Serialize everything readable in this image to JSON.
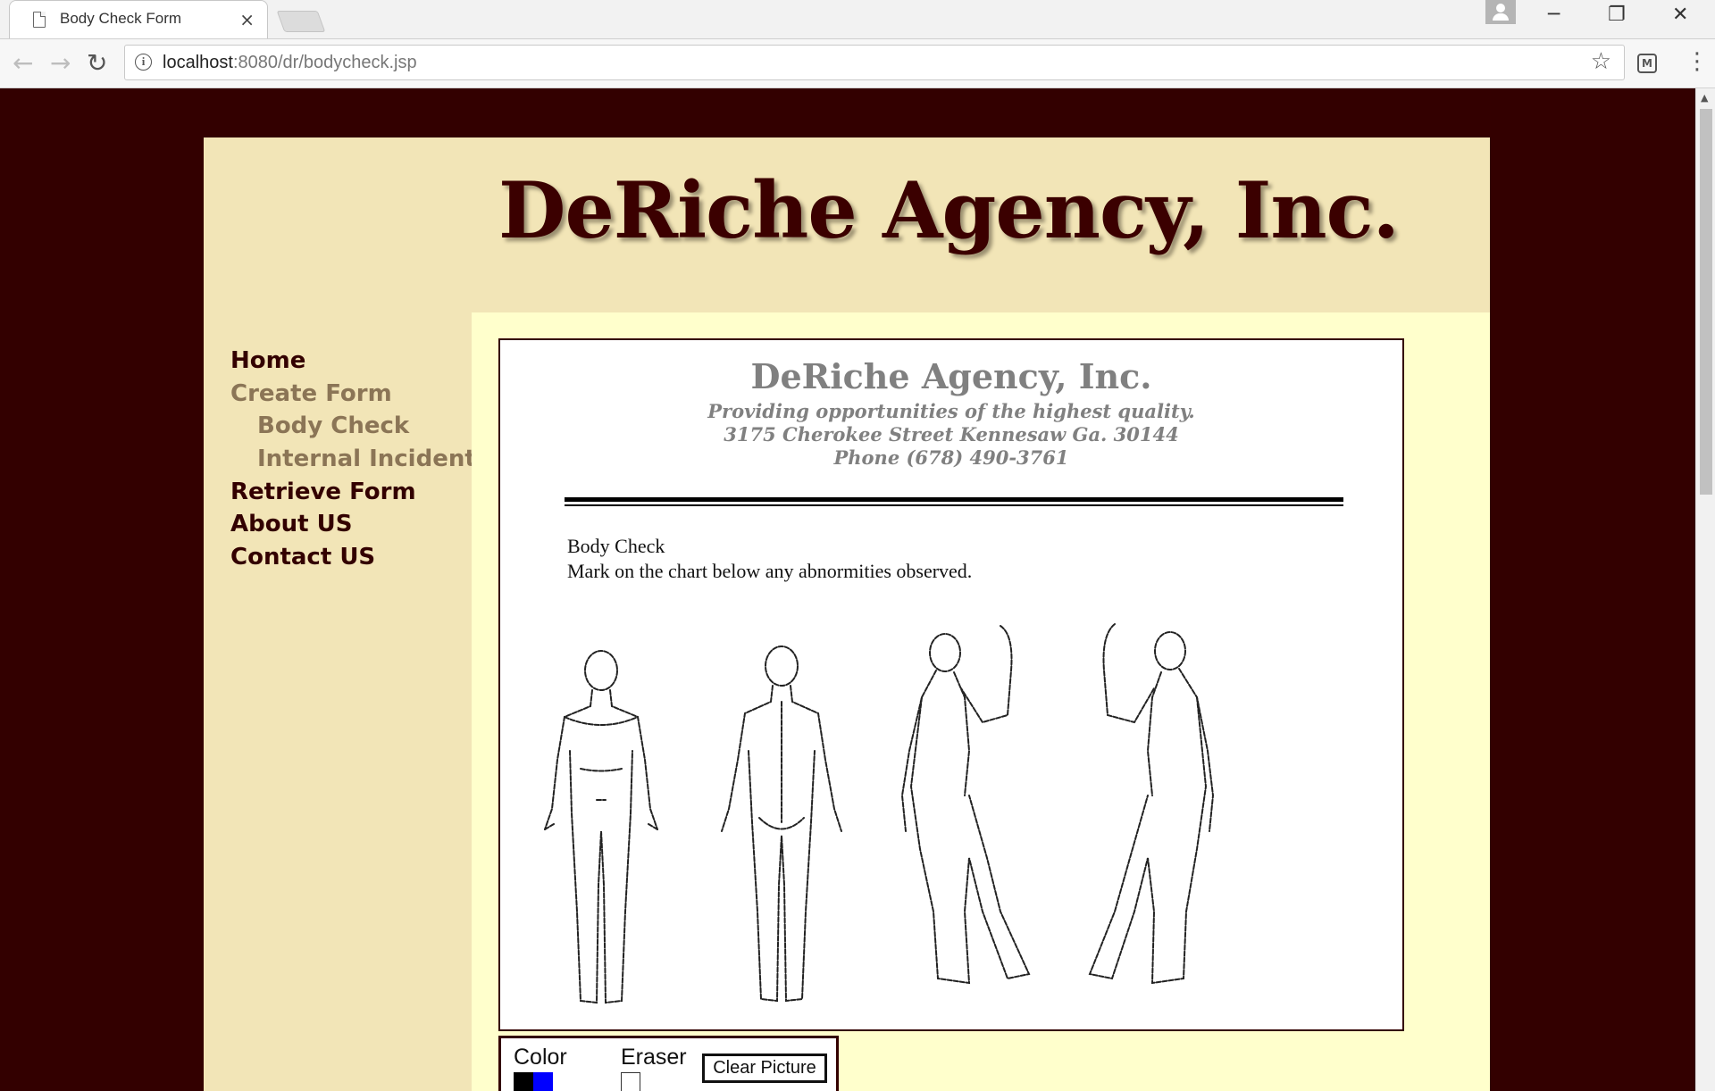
{
  "browser": {
    "tab_title": "Body Check Form",
    "tab_close": "×",
    "url_host": "localhost",
    "url_path": ":8080/dr/bodycheck.jsp",
    "back": "←",
    "forward": "→",
    "reload": "↻",
    "bookmark": "☆",
    "menu": "⋮",
    "minimize": "─",
    "restore": "❐",
    "close": "✕"
  },
  "site": {
    "title": "DeRiche Agency, Inc."
  },
  "nav": {
    "items": [
      {
        "label": "Home"
      },
      {
        "label": "Create Form"
      },
      {
        "label": "Body Check"
      },
      {
        "label": "Internal Incident"
      },
      {
        "label": "Retrieve Form"
      },
      {
        "label": "About US"
      },
      {
        "label": "Contact US"
      }
    ]
  },
  "letterhead": {
    "name": "DeRiche Agency, Inc.",
    "tagline": "Providing opportunities of the highest quality.",
    "address": "3175 Cherokee Street Kennesaw Ga. 30144",
    "phone": "Phone (678) 490-3761"
  },
  "form": {
    "title": "Body Check",
    "instruction": "Mark on the chart below any abnormities observed."
  },
  "tools": {
    "color_label": "Color",
    "eraser_label": "Eraser",
    "clear_button": "Clear Picture",
    "colors": [
      "#000000",
      "#0000ff"
    ]
  },
  "icons": {
    "tab_icon": "document-icon",
    "info": "info-icon",
    "extension": "extension-icon",
    "profile": "profile-icon"
  }
}
